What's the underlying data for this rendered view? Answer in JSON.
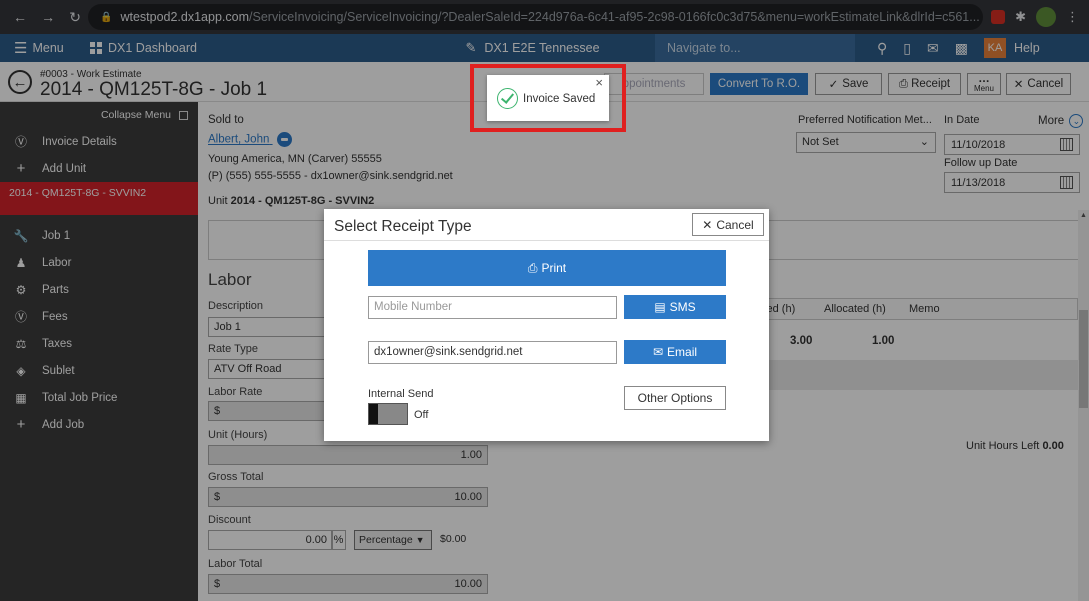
{
  "browser": {
    "url_host": "wtestpod2.dx1app.com",
    "url_path": "/ServiceInvoicing/ServiceInvoicing/?DealerSaleId=224d976a-6c41-af95-2c98-0166fc0c3d75&menu=workEstimateLink&dlrId=c561..."
  },
  "appbar": {
    "menu_label": "Menu",
    "dashboard_label": "DX1 Dashboard",
    "dealer_label": "DX1 E2E Tennessee",
    "navigate_placeholder": "Navigate to...",
    "user_initials": "KA",
    "help_label": "Help"
  },
  "header": {
    "subtitle": "#0003 - Work Estimate",
    "title": "2014 - QM125T-8G - Job 1",
    "buttons": {
      "appointments": "ppointments",
      "convert": "Convert To R.O.",
      "save": "Save",
      "receipt": "Receipt",
      "menu": "Menu",
      "cancel": "Cancel"
    }
  },
  "sidebar": {
    "collapse_label": "Collapse Menu",
    "items_top": [
      {
        "label": "Invoice Details",
        "icon": "dollar-circle-icon"
      },
      {
        "label": "Add Unit",
        "icon": "plus-icon"
      }
    ],
    "unit_label": "2014 - QM125T-8G - SVVIN2",
    "items_bottom": [
      {
        "label": "Job 1",
        "icon": "wrench-icon"
      },
      {
        "label": "Labor",
        "icon": "workers-icon"
      },
      {
        "label": "Parts",
        "icon": "gear-icon"
      },
      {
        "label": "Fees",
        "icon": "dollar-circle-icon"
      },
      {
        "label": "Taxes",
        "icon": "taxes-icon"
      },
      {
        "label": "Sublet",
        "icon": "tag-icon"
      },
      {
        "label": "Total Job Price",
        "icon": "calculator-icon"
      },
      {
        "label": "Add Job",
        "icon": "plus-icon"
      }
    ]
  },
  "customer": {
    "sold_to_label": "Sold to",
    "name": "Albert, John",
    "address": "Young America, MN (Carver) 55555",
    "contact": "(P) (555) 555-5555 - dx1owner@sink.sendgrid.net",
    "unit_prefix": "Unit",
    "unit_value": "2014 - QM125T-8G - SVVIN2"
  },
  "right_panel": {
    "pref_label": "Preferred Notification Met...",
    "pref_value": "Not Set",
    "in_date_label": "In Date",
    "in_date": "11/10/2018",
    "more_label": "More",
    "follow_up_label": "Follow up Date",
    "follow_up_date": "11/13/2018"
  },
  "labor": {
    "section_title": "Labor",
    "description_label": "Description",
    "description_value": "Job 1",
    "rate_type_label": "Rate Type",
    "rate_type_value": "ATV Off Road",
    "labor_rate_label": "Labor Rate",
    "labor_rate_prefix": "$",
    "unit_hours_label": "Unit (Hours)",
    "unit_hours_value": "1.00",
    "gross_total_label": "Gross Total",
    "gross_total_prefix": "$",
    "gross_total_value": "10.00",
    "discount_label": "Discount",
    "discount_value": "0.00",
    "discount_pct_symbol": "%",
    "discount_type": "Percentage",
    "discount_amount": "$0.00",
    "labor_total_label": "Labor Total",
    "labor_total_prefix": "$",
    "labor_total_value": "10.00"
  },
  "labor_grid": {
    "columns": [
      "ked (h)",
      "Allocated (h)",
      "Memo"
    ],
    "row": [
      "3.00",
      "1.00",
      ""
    ],
    "hours_left_label": "Unit Hours Left",
    "hours_left_value": "0.00"
  },
  "modal": {
    "title": "Select Receipt Type",
    "cancel_label": "Cancel",
    "print_label": "Print",
    "mobile_placeholder": "Mobile Number",
    "sms_label": "SMS",
    "email_value": "dx1owner@sink.sendgrid.net",
    "email_label": "Email",
    "internal_send_label": "Internal Send",
    "toggle_state": "Off",
    "other_options_label": "Other Options"
  },
  "toast": {
    "message": "Invoice Saved"
  },
  "colors": {
    "appbar": "#2d5c8a",
    "primary_button": "#2d7ac8",
    "sidebar": "#3c3c3c",
    "sidebar_active": "#d3222a",
    "highlight": "#e0201f",
    "success": "#3cb46e"
  }
}
